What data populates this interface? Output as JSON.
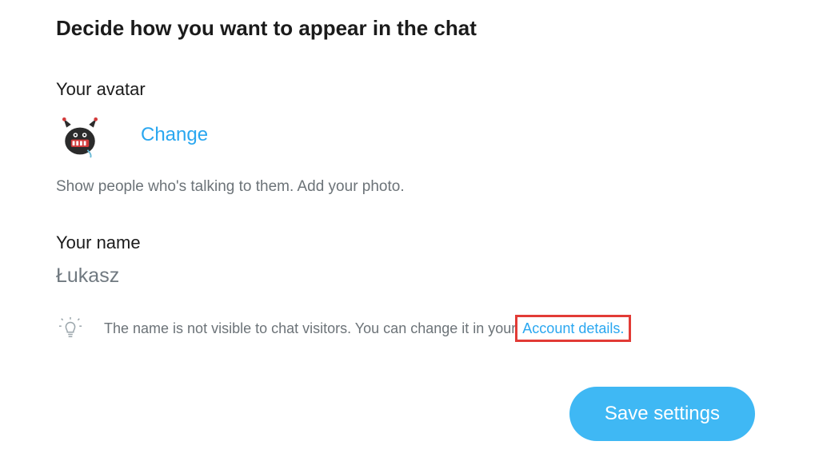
{
  "title": "Decide how you want to appear in the chat",
  "avatar": {
    "label": "Your avatar",
    "change_label": "Change",
    "helper": "Show people who's talking to them. Add your photo."
  },
  "name": {
    "label": "Your name",
    "value": "Łukasz",
    "tip_prefix": "The name is not visible to chat visitors. You can change it in your ",
    "tip_link": "Account details.",
    "tip_suffix": ""
  },
  "save_label": "Save settings"
}
